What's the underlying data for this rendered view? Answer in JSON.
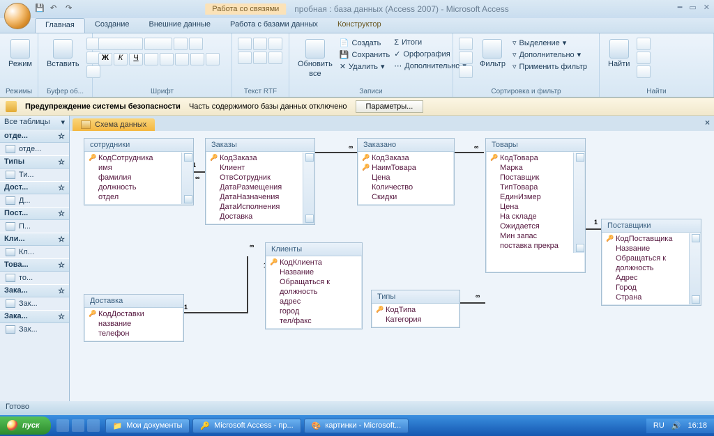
{
  "titlebar": {
    "context_label": "Работа со связями",
    "app_title": "пробная : база данных (Access 2007) - Microsoft Access"
  },
  "tabs": {
    "home": "Главная",
    "create": "Создание",
    "external": "Внешние данные",
    "dbwork": "Работа с базами данных",
    "constructor": "Конструктор"
  },
  "ribbon": {
    "modes": "Режим",
    "modes_grp": "Режимы",
    "paste": "Вставить",
    "clip_grp": "Буфер об...",
    "font_grp": "Шрифт",
    "rtf_grp": "Текст RTF",
    "refresh": "Обновить",
    "refresh2": "все",
    "records_grp": "Записи",
    "create_rec": "Создать",
    "save_rec": "Сохранить",
    "delete_rec": "Удалить",
    "totals": "Итоги",
    "spell": "Орфография",
    "more": "Дополнительно",
    "filter": "Фильтр",
    "sel": "Выделение",
    "adv": "Дополнительно",
    "apply": "Применить фильтр",
    "sortfilt_grp": "Сортировка и фильтр",
    "find": "Найти",
    "find_grp": "Найти"
  },
  "security": {
    "title": "Предупреждение системы безопасности",
    "msg": "Часть содержимого базы данных отключено",
    "btn": "Параметры..."
  },
  "nav": {
    "header": "Все таблицы",
    "groups": [
      {
        "name": "отде...",
        "items": [
          "отде..."
        ]
      },
      {
        "name": "Типы",
        "items": [
          "Ти..."
        ]
      },
      {
        "name": "Дост...",
        "items": [
          "Д..."
        ]
      },
      {
        "name": "Пост...",
        "items": [
          "П..."
        ]
      },
      {
        "name": "Кли...",
        "items": [
          "Кл..."
        ]
      },
      {
        "name": "Това...",
        "items": [
          "то..."
        ]
      },
      {
        "name": "Зака...",
        "items": [
          "Зак..."
        ]
      },
      {
        "name": "Зака...",
        "items": [
          "Зак..."
        ]
      }
    ]
  },
  "doc": {
    "tab": "Схема данных"
  },
  "entities": {
    "sotrudniki": {
      "title": "сотрудники",
      "fields": [
        "КодСотрудника",
        "имя",
        "фамилия",
        "должность",
        "отдел"
      ],
      "keys": [
        0
      ]
    },
    "zakazy": {
      "title": "Заказы",
      "fields": [
        "КодЗаказа",
        "Клиент",
        "ОтвСотрудник",
        "ДатаРазмещения",
        "ДатаНазначения",
        "ДатаИсполнения",
        "Доставка"
      ],
      "keys": [
        0
      ]
    },
    "zakazano": {
      "title": "Заказано",
      "fields": [
        "КодЗаказа",
        "НаимТовара",
        "Цена",
        "Количество",
        "Скидки"
      ],
      "keys": [
        0,
        1
      ]
    },
    "tovary": {
      "title": "Товары",
      "fields": [
        "КодТовара",
        "Марка",
        "Поставщик",
        "ТипТовара",
        "ЕдинИзмер",
        "Цена",
        "На складе",
        "Ожидается",
        "Мин запас",
        "поставка прекра"
      ],
      "keys": [
        0
      ]
    },
    "postavshiki": {
      "title": "Поставщики",
      "fields": [
        "КодПоставщика",
        "Название",
        "Обращаться к",
        "должность",
        "Адрес",
        "Город",
        "Страна"
      ],
      "keys": [
        0
      ]
    },
    "klienty": {
      "title": "Клиенты",
      "fields": [
        "КодКлиента",
        "Название",
        "Обращаться к",
        "должность",
        "адрес",
        "город",
        "тел/факс"
      ],
      "keys": [
        0
      ]
    },
    "dostavka": {
      "title": "Доставка",
      "fields": [
        "КодДоставки",
        "название",
        "телефон"
      ],
      "keys": [
        0
      ]
    },
    "tipy": {
      "title": "Типы",
      "fields": [
        "КодТипа",
        "Категория"
      ],
      "keys": [
        0
      ]
    }
  },
  "status": "Готово",
  "taskbar": {
    "start": "пуск",
    "t1": "Мои документы",
    "t2": "Microsoft Access - пр...",
    "t3": "картинки - Microsoft...",
    "lang": "RU",
    "time": "16:18"
  }
}
